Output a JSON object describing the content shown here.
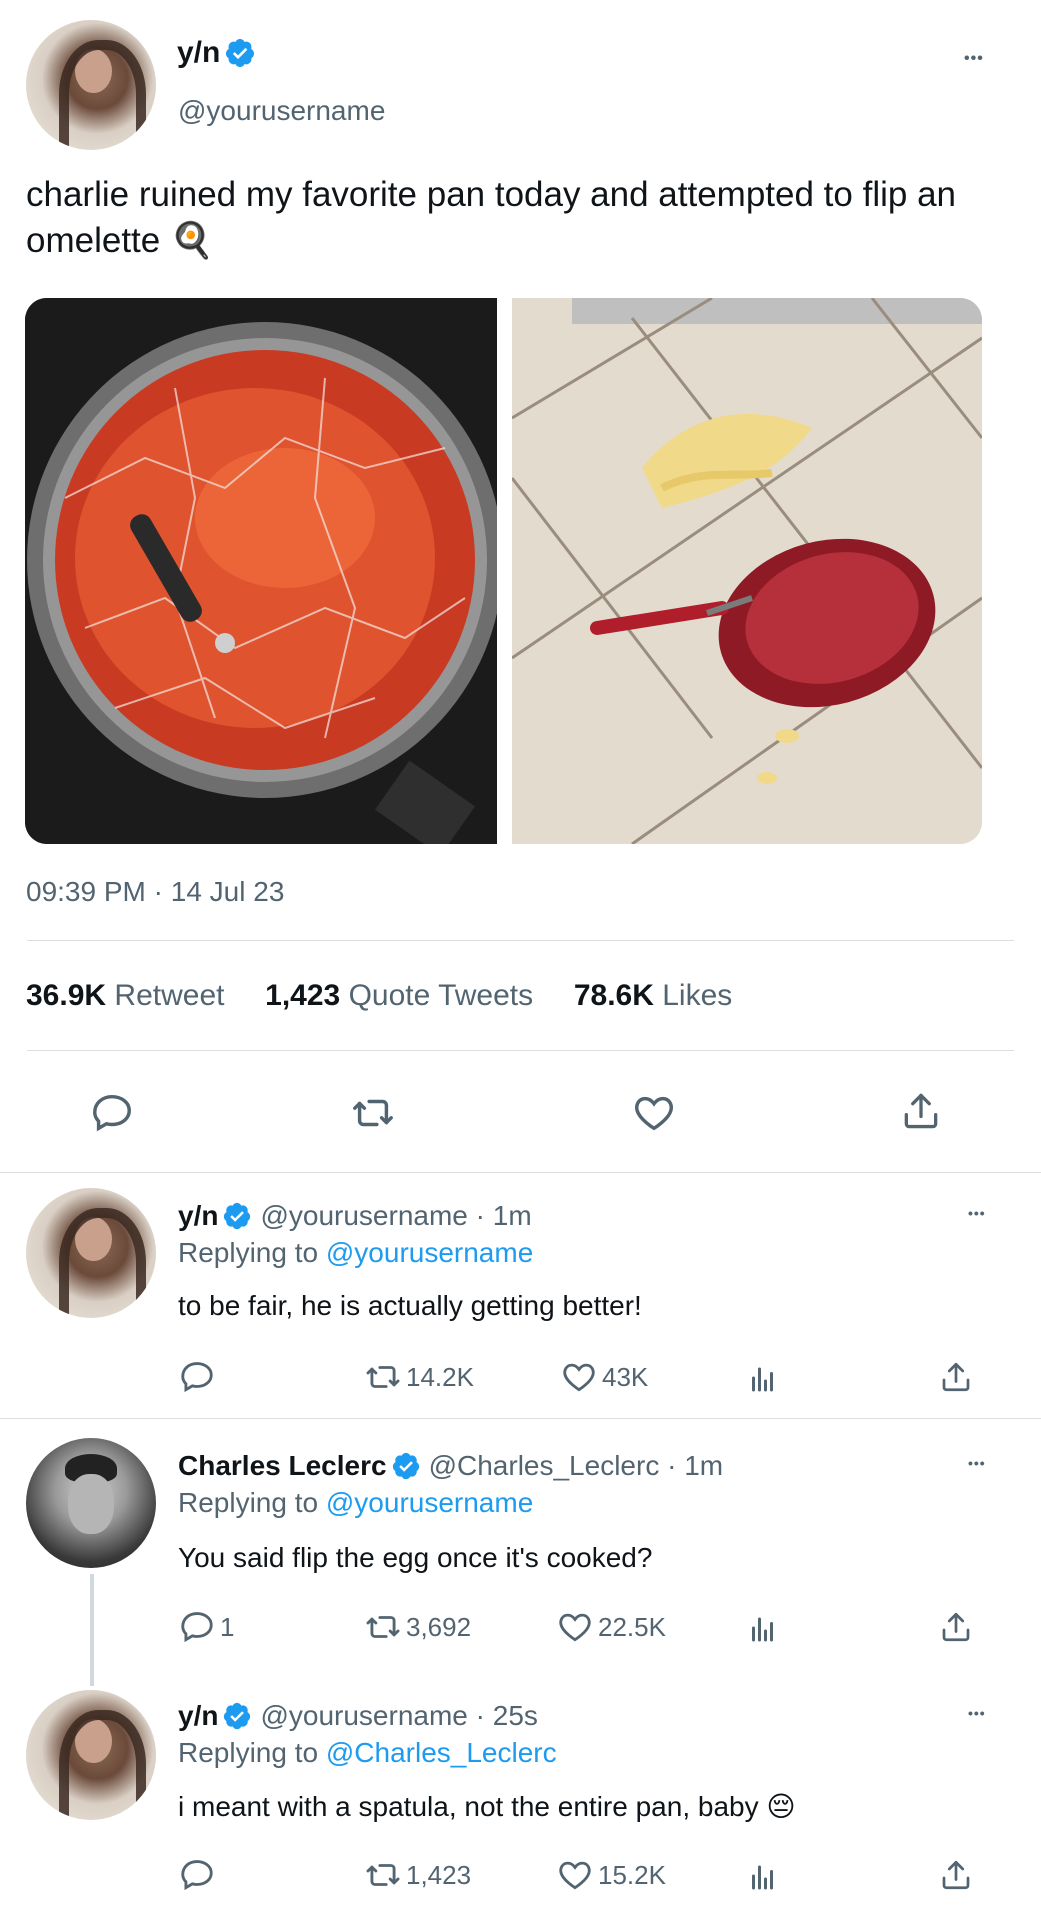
{
  "main_tweet": {
    "display_name": "y/n",
    "handle": "@yourusername",
    "text": "charlie ruined my favorite pan today and attempted to flip an omelette",
    "text_emoji": "🍳",
    "time": "09:39 PM",
    "date_separator": "·",
    "date": "14 Jul 23",
    "stats": {
      "retweets_count": "36.9K",
      "retweets_label": "Retweet",
      "quotes_count": "1,423",
      "quotes_label": "Quote Tweets",
      "likes_count": "78.6K",
      "likes_label": "Likes"
    },
    "more": "•••"
  },
  "replies": [
    {
      "display_name": "y/n",
      "handle_time": "@yourusername · 1m",
      "replying_prefix": "Replying to",
      "replying_to": "@yourusername",
      "text": "to be fair, he is actually getting better!",
      "emoji": "",
      "reply_count": "",
      "retweet_count": "14.2K",
      "like_count": "43K",
      "more": "•••"
    },
    {
      "display_name": "Charles Leclerc",
      "handle_time": "@Charles_Leclerc · 1m",
      "replying_prefix": "Replying to",
      "replying_to": "@yourusername",
      "text": "You said flip the egg once it's cooked?",
      "emoji": "",
      "reply_count": "1",
      "retweet_count": "3,692",
      "like_count": "22.5K",
      "more": "•••"
    },
    {
      "display_name": "y/n",
      "handle_time": "@yourusername · 25s",
      "replying_prefix": "Replying to",
      "replying_to": "@Charles_Leclerc",
      "text": "i meant with a spatula, not the entire pan, baby",
      "emoji": "😔",
      "reply_count": "",
      "retweet_count": "1,423",
      "like_count": "15.2K",
      "more": "•••"
    }
  ],
  "colors": {
    "accent": "#1d9bf0",
    "muted": "#536471",
    "text": "#0f1419"
  },
  "icons": [
    "verified-badge-icon",
    "more-icon",
    "reply-icon",
    "retweet-icon",
    "like-icon",
    "share-icon",
    "views-icon"
  ]
}
